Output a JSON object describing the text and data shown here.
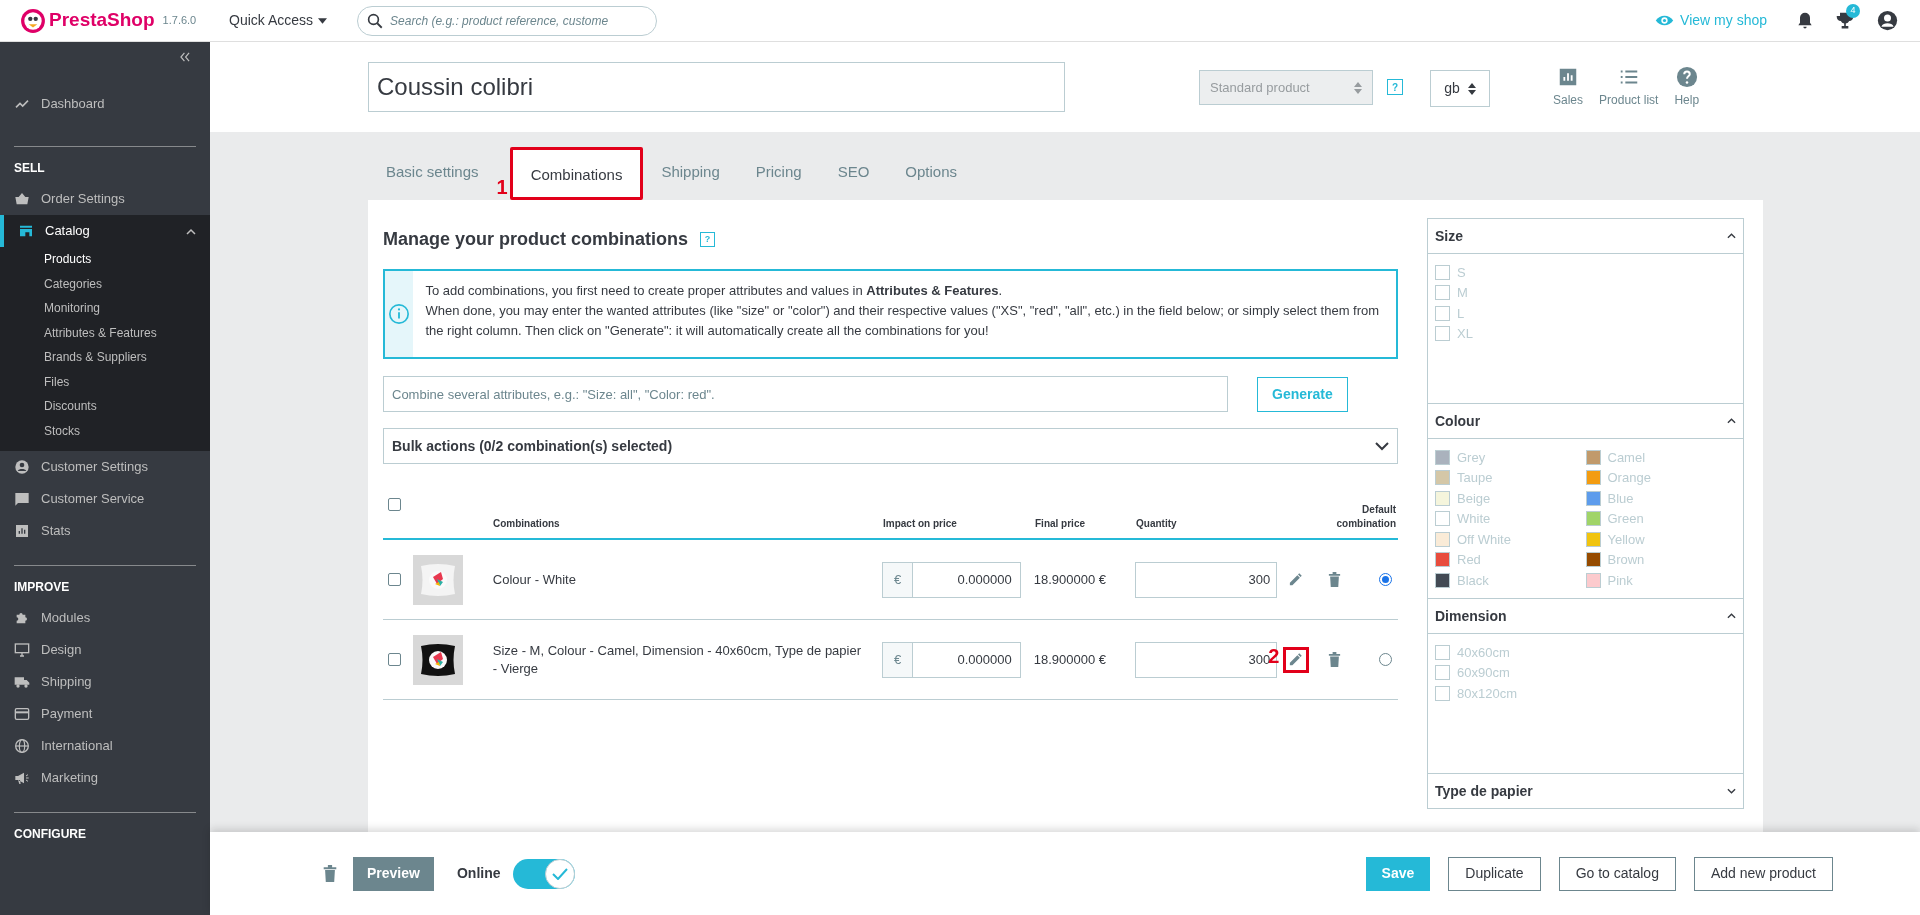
{
  "top_bar": {
    "brand": "PrestaShop",
    "version": "1.7.6.0",
    "quick_access": "Quick Access",
    "search_placeholder": "Search (e.g.: product reference, custome",
    "view_shop": "View my shop",
    "notification_count": "4"
  },
  "sidebar": {
    "items": [
      {
        "kind": "item",
        "label": "Dashboard",
        "selected": false
      },
      {
        "kind": "heading",
        "label": "SELL"
      },
      {
        "kind": "item",
        "label": "Order Settings",
        "selected": false
      },
      {
        "kind": "item",
        "label": "Catalog",
        "selected": true,
        "expanded": true,
        "children": [
          {
            "label": "Products",
            "selected": true
          },
          {
            "label": "Categories",
            "selected": false
          },
          {
            "label": "Monitoring",
            "selected": false
          },
          {
            "label": "Attributes & Features",
            "selected": false
          },
          {
            "label": "Brands & Suppliers",
            "selected": false
          },
          {
            "label": "Files",
            "selected": false
          },
          {
            "label": "Discounts",
            "selected": false
          },
          {
            "label": "Stocks",
            "selected": false
          }
        ]
      },
      {
        "kind": "item",
        "label": "Customer Settings",
        "selected": false
      },
      {
        "kind": "item",
        "label": "Customer Service",
        "selected": false
      },
      {
        "kind": "item",
        "label": "Stats",
        "selected": false
      },
      {
        "kind": "heading",
        "label": "IMPROVE"
      },
      {
        "kind": "item",
        "label": "Modules",
        "selected": false
      },
      {
        "kind": "item",
        "label": "Design",
        "selected": false
      },
      {
        "kind": "item",
        "label": "Shipping",
        "selected": false
      },
      {
        "kind": "item",
        "label": "Payment",
        "selected": false
      },
      {
        "kind": "item",
        "label": "International",
        "selected": false
      },
      {
        "kind": "item",
        "label": "Marketing",
        "selected": false
      },
      {
        "kind": "heading",
        "label": "CONFIGURE"
      }
    ]
  },
  "product_header": {
    "name": "Coussin colibri",
    "product_type": "Standard product",
    "help": "?",
    "language": "gb",
    "actions": [
      "Sales",
      "Product list",
      "Help"
    ]
  },
  "tabs": [
    {
      "label": "Basic settings",
      "selected": false
    },
    {
      "label": "Combinations",
      "selected": true,
      "annotation": "1"
    },
    {
      "label": "Shipping",
      "selected": false
    },
    {
      "label": "Pricing",
      "selected": false
    },
    {
      "label": "SEO",
      "selected": false
    },
    {
      "label": "Options",
      "selected": false
    }
  ],
  "combinations": {
    "title": "Manage your product combinations",
    "help": "?",
    "info": [
      "To add combinations, you first need to create proper attributes and values in **Attributes & Features**.",
      "When done, you may enter the wanted attributes (like \"size\" or \"color\") and their respective values (\"XS\", \"red\", \"all\", etc.) in the field below; or simply select them from the right column. Then click on \"Generate\": it will automatically create all the combinations for you!"
    ],
    "combine_placeholder": "Combine several attributes, e.g.: \"Size: all\", \"Color: red\".",
    "generate": "Generate",
    "bulk_actions": "Bulk actions (0/2 combination(s) selected)",
    "bulk_expanded": false,
    "all_checked": false,
    "columns": [
      "Combinations",
      "Impact on price",
      "Final price",
      "Quantity",
      "Default combination"
    ],
    "rows": [
      {
        "checked": false,
        "name": "Colour - White",
        "currency": "€",
        "impact": "0.000000",
        "final_price": "18.900000 €",
        "quantity": "300",
        "default": true
      },
      {
        "checked": false,
        "name": "Size - M, Colour - Camel, Dimension - 40x60cm, Type de papier - Vierge",
        "currency": "€",
        "impact": "0.000000",
        "final_price": "18.900000 €",
        "quantity": "300",
        "default": false,
        "edit_annotation": "2"
      }
    ]
  },
  "attribute_groups": [
    {
      "title": "Size",
      "expanded": true,
      "values": [
        {
          "label": "S",
          "checked": false
        },
        {
          "label": "M",
          "checked": false
        },
        {
          "label": "L",
          "checked": false
        },
        {
          "label": "XL",
          "checked": false
        }
      ]
    },
    {
      "title": "Colour",
      "expanded": true,
      "values": [
        {
          "label": "Grey",
          "checked": false,
          "color": "#aab2bd"
        },
        {
          "label": "Camel",
          "checked": false,
          "color": "#c19a6b"
        },
        {
          "label": "Taupe",
          "checked": false,
          "color": "#d4c7a7"
        },
        {
          "label": "Orange",
          "checked": false,
          "color": "#f39c11"
        },
        {
          "label": "Beige",
          "checked": false,
          "color": "#f5f5dc"
        },
        {
          "label": "Blue",
          "checked": false,
          "color": "#5d9cec"
        },
        {
          "label": "White",
          "checked": false,
          "color": "#ffffff"
        },
        {
          "label": "Green",
          "checked": false,
          "color": "#a0d468"
        },
        {
          "label": "Off White",
          "checked": false,
          "color": "#faebd7"
        },
        {
          "label": "Yellow",
          "checked": false,
          "color": "#f1c40f"
        },
        {
          "label": "Red",
          "checked": false,
          "color": "#e84c3d"
        },
        {
          "label": "Brown",
          "checked": false,
          "color": "#964b00"
        },
        {
          "label": "Black",
          "checked": false,
          "color": "#434a54"
        },
        {
          "label": "Pink",
          "checked": false,
          "color": "#fccacd"
        }
      ]
    },
    {
      "title": "Dimension",
      "expanded": true,
      "values": [
        {
          "label": "40x60cm",
          "checked": false
        },
        {
          "label": "60x90cm",
          "checked": false
        },
        {
          "label": "80x120cm",
          "checked": false
        }
      ]
    },
    {
      "title": "Type de papier",
      "expanded": false
    }
  ],
  "footer": {
    "preview": "Preview",
    "online_label": "Online",
    "online": true,
    "buttons": [
      {
        "label": "Save",
        "kind": "primary"
      },
      {
        "label": "Duplicate",
        "kind": "outline"
      },
      {
        "label": "Go to catalog",
        "kind": "outline"
      },
      {
        "label": "Add new product",
        "kind": "outline"
      }
    ]
  }
}
